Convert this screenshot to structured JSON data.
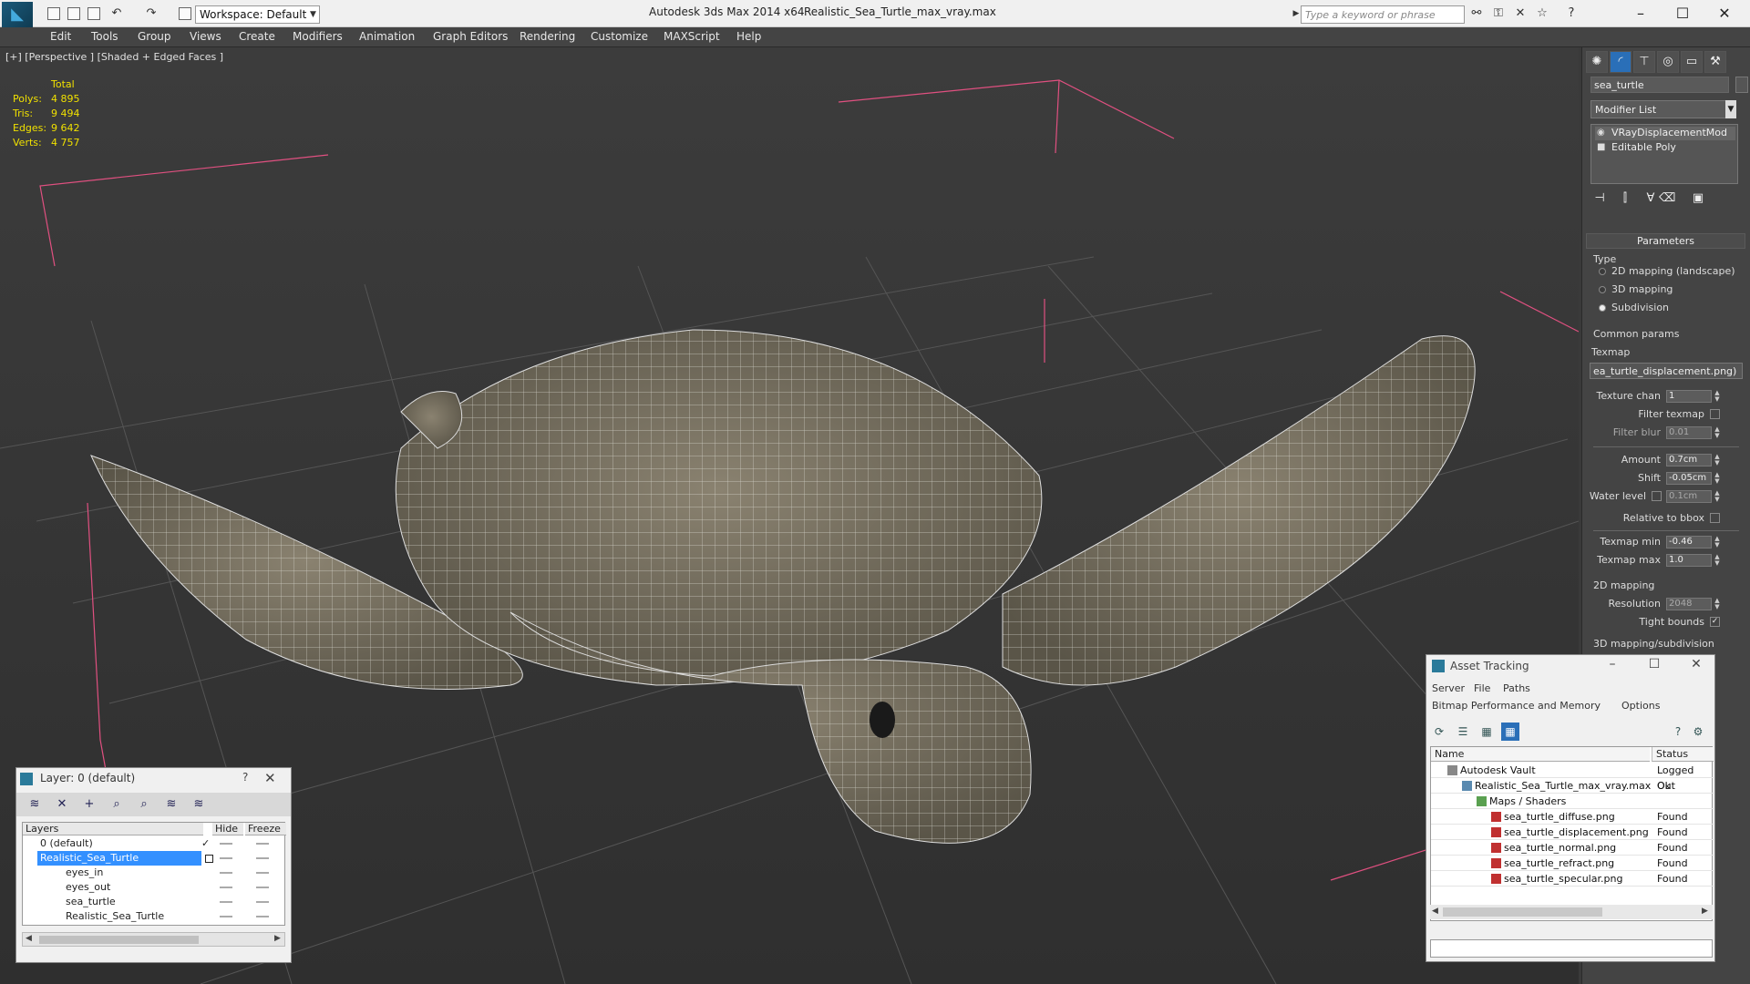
{
  "titlebar": {
    "workspace": "Workspace: Default",
    "app_title": "Autodesk 3ds Max  2014 x64",
    "file_title": "Realistic_Sea_Turtle_max_vray.max",
    "search_placeholder": "Type a keyword or phrase"
  },
  "menu": [
    "Edit",
    "Tools",
    "Group",
    "Views",
    "Create",
    "Modifiers",
    "Animation",
    "Graph Editors",
    "Rendering",
    "Customize",
    "MAXScript",
    "Help"
  ],
  "viewport": {
    "label": "[+] [Perspective ] [Shaded + Edged Faces ]",
    "stats_header": "Total",
    "stats": [
      {
        "label": "Polys:",
        "value": "4 895"
      },
      {
        "label": "Tris:",
        "value": "9 494"
      },
      {
        "label": "Edges:",
        "value": "9 642"
      },
      {
        "label": "Verts:",
        "value": "4 757"
      }
    ]
  },
  "command_panel": {
    "object_name": "sea_turtle",
    "modifier_list": "Modifier List",
    "stack": [
      {
        "label": "VRayDisplacementMod",
        "icon": "bulb-icon"
      },
      {
        "label": "Editable Poly",
        "icon": "square-icon"
      }
    ],
    "params_title": "Parameters",
    "type_label": "Type",
    "type_options": [
      {
        "label": "2D mapping (landscape)",
        "checked": false
      },
      {
        "label": "3D mapping",
        "checked": false
      },
      {
        "label": "Subdivision",
        "checked": true
      }
    ],
    "common_params": "Common params",
    "texmap_label": "Texmap",
    "texmap_value": "ea_turtle_displacement.png)",
    "texture_chan_label": "Texture chan",
    "texture_chan": "1",
    "filter_texmap": "Filter texmap",
    "filter_blur_label": "Filter blur",
    "filter_blur": "0.01",
    "amount_label": "Amount",
    "amount": "0.7cm",
    "shift_label": "Shift",
    "shift": "-0.05cm",
    "water_level_label": "Water level",
    "water_level": "0.1cm",
    "relative_bbox": "Relative to bbox",
    "texmap_min_label": "Texmap min",
    "texmap_min": "-0.46",
    "texmap_max_label": "Texmap max",
    "texmap_max": "1.0",
    "mapping2d_label": "2D mapping",
    "resolution_label": "Resolution",
    "resolution": "2048",
    "tight_bounds": "Tight bounds",
    "mapping3d_label": "3D mapping/subdivision"
  },
  "layer_dialog": {
    "title": "Layer: 0 (default)",
    "help": "?",
    "col_layers": "Layers",
    "col_hide": "Hide",
    "col_freeze": "Freeze",
    "rows": [
      {
        "name": "0 (default)",
        "indent": 0
      },
      {
        "name": "Realistic_Sea_Turtle",
        "indent": 0,
        "selected": true
      },
      {
        "name": "eyes_in",
        "indent": 1
      },
      {
        "name": "eyes_out",
        "indent": 1
      },
      {
        "name": "sea_turtle",
        "indent": 1
      },
      {
        "name": "Realistic_Sea_Turtle",
        "indent": 1
      }
    ]
  },
  "asset_dialog": {
    "title": "Asset Tracking",
    "menu1": [
      "Server",
      "File",
      "Paths"
    ],
    "menu2": [
      "Bitmap Performance and Memory",
      "Options"
    ],
    "col_name": "Name",
    "col_status": "Status",
    "rows": [
      {
        "name": "Autodesk Vault",
        "status": "Logged Out",
        "indent": 0
      },
      {
        "name": "Realistic_Sea_Turtle_max_vray.max",
        "status": "Ok",
        "indent": 1
      },
      {
        "name": "Maps / Shaders",
        "status": "",
        "indent": 2
      },
      {
        "name": "sea_turtle_diffuse.png",
        "status": "Found",
        "indent": 3
      },
      {
        "name": "sea_turtle_displacement.png",
        "status": "Found",
        "indent": 3
      },
      {
        "name": "sea_turtle_normal.png",
        "status": "Found",
        "indent": 3
      },
      {
        "name": "sea_turtle_refract.png",
        "status": "Found",
        "indent": 3
      },
      {
        "name": "sea_turtle_specular.png",
        "status": "Found",
        "indent": 3
      }
    ]
  }
}
